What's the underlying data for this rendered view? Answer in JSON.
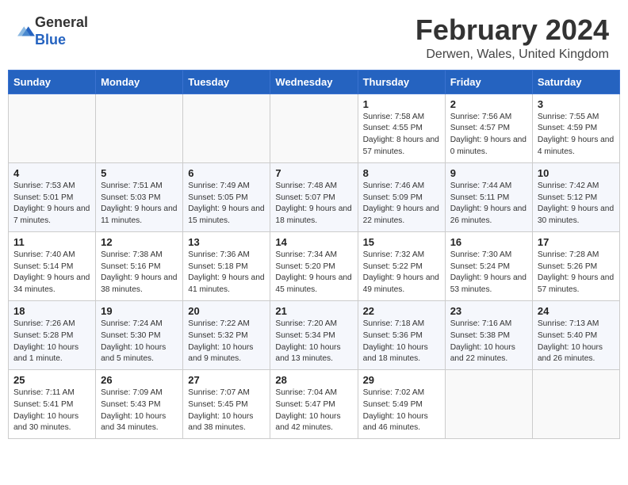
{
  "header": {
    "logo_general": "General",
    "logo_blue": "Blue",
    "month_year": "February 2024",
    "location": "Derwen, Wales, United Kingdom"
  },
  "days_of_week": [
    "Sunday",
    "Monday",
    "Tuesday",
    "Wednesday",
    "Thursday",
    "Friday",
    "Saturday"
  ],
  "weeks": [
    [
      {
        "day": "",
        "info": ""
      },
      {
        "day": "",
        "info": ""
      },
      {
        "day": "",
        "info": ""
      },
      {
        "day": "",
        "info": ""
      },
      {
        "day": "1",
        "info": "Sunrise: 7:58 AM\nSunset: 4:55 PM\nDaylight: 8 hours and 57 minutes."
      },
      {
        "day": "2",
        "info": "Sunrise: 7:56 AM\nSunset: 4:57 PM\nDaylight: 9 hours and 0 minutes."
      },
      {
        "day": "3",
        "info": "Sunrise: 7:55 AM\nSunset: 4:59 PM\nDaylight: 9 hours and 4 minutes."
      }
    ],
    [
      {
        "day": "4",
        "info": "Sunrise: 7:53 AM\nSunset: 5:01 PM\nDaylight: 9 hours and 7 minutes."
      },
      {
        "day": "5",
        "info": "Sunrise: 7:51 AM\nSunset: 5:03 PM\nDaylight: 9 hours and 11 minutes."
      },
      {
        "day": "6",
        "info": "Sunrise: 7:49 AM\nSunset: 5:05 PM\nDaylight: 9 hours and 15 minutes."
      },
      {
        "day": "7",
        "info": "Sunrise: 7:48 AM\nSunset: 5:07 PM\nDaylight: 9 hours and 18 minutes."
      },
      {
        "day": "8",
        "info": "Sunrise: 7:46 AM\nSunset: 5:09 PM\nDaylight: 9 hours and 22 minutes."
      },
      {
        "day": "9",
        "info": "Sunrise: 7:44 AM\nSunset: 5:11 PM\nDaylight: 9 hours and 26 minutes."
      },
      {
        "day": "10",
        "info": "Sunrise: 7:42 AM\nSunset: 5:12 PM\nDaylight: 9 hours and 30 minutes."
      }
    ],
    [
      {
        "day": "11",
        "info": "Sunrise: 7:40 AM\nSunset: 5:14 PM\nDaylight: 9 hours and 34 minutes."
      },
      {
        "day": "12",
        "info": "Sunrise: 7:38 AM\nSunset: 5:16 PM\nDaylight: 9 hours and 38 minutes."
      },
      {
        "day": "13",
        "info": "Sunrise: 7:36 AM\nSunset: 5:18 PM\nDaylight: 9 hours and 41 minutes."
      },
      {
        "day": "14",
        "info": "Sunrise: 7:34 AM\nSunset: 5:20 PM\nDaylight: 9 hours and 45 minutes."
      },
      {
        "day": "15",
        "info": "Sunrise: 7:32 AM\nSunset: 5:22 PM\nDaylight: 9 hours and 49 minutes."
      },
      {
        "day": "16",
        "info": "Sunrise: 7:30 AM\nSunset: 5:24 PM\nDaylight: 9 hours and 53 minutes."
      },
      {
        "day": "17",
        "info": "Sunrise: 7:28 AM\nSunset: 5:26 PM\nDaylight: 9 hours and 57 minutes."
      }
    ],
    [
      {
        "day": "18",
        "info": "Sunrise: 7:26 AM\nSunset: 5:28 PM\nDaylight: 10 hours and 1 minute."
      },
      {
        "day": "19",
        "info": "Sunrise: 7:24 AM\nSunset: 5:30 PM\nDaylight: 10 hours and 5 minutes."
      },
      {
        "day": "20",
        "info": "Sunrise: 7:22 AM\nSunset: 5:32 PM\nDaylight: 10 hours and 9 minutes."
      },
      {
        "day": "21",
        "info": "Sunrise: 7:20 AM\nSunset: 5:34 PM\nDaylight: 10 hours and 13 minutes."
      },
      {
        "day": "22",
        "info": "Sunrise: 7:18 AM\nSunset: 5:36 PM\nDaylight: 10 hours and 18 minutes."
      },
      {
        "day": "23",
        "info": "Sunrise: 7:16 AM\nSunset: 5:38 PM\nDaylight: 10 hours and 22 minutes."
      },
      {
        "day": "24",
        "info": "Sunrise: 7:13 AM\nSunset: 5:40 PM\nDaylight: 10 hours and 26 minutes."
      }
    ],
    [
      {
        "day": "25",
        "info": "Sunrise: 7:11 AM\nSunset: 5:41 PM\nDaylight: 10 hours and 30 minutes."
      },
      {
        "day": "26",
        "info": "Sunrise: 7:09 AM\nSunset: 5:43 PM\nDaylight: 10 hours and 34 minutes."
      },
      {
        "day": "27",
        "info": "Sunrise: 7:07 AM\nSunset: 5:45 PM\nDaylight: 10 hours and 38 minutes."
      },
      {
        "day": "28",
        "info": "Sunrise: 7:04 AM\nSunset: 5:47 PM\nDaylight: 10 hours and 42 minutes."
      },
      {
        "day": "29",
        "info": "Sunrise: 7:02 AM\nSunset: 5:49 PM\nDaylight: 10 hours and 46 minutes."
      },
      {
        "day": "",
        "info": ""
      },
      {
        "day": "",
        "info": ""
      }
    ]
  ]
}
